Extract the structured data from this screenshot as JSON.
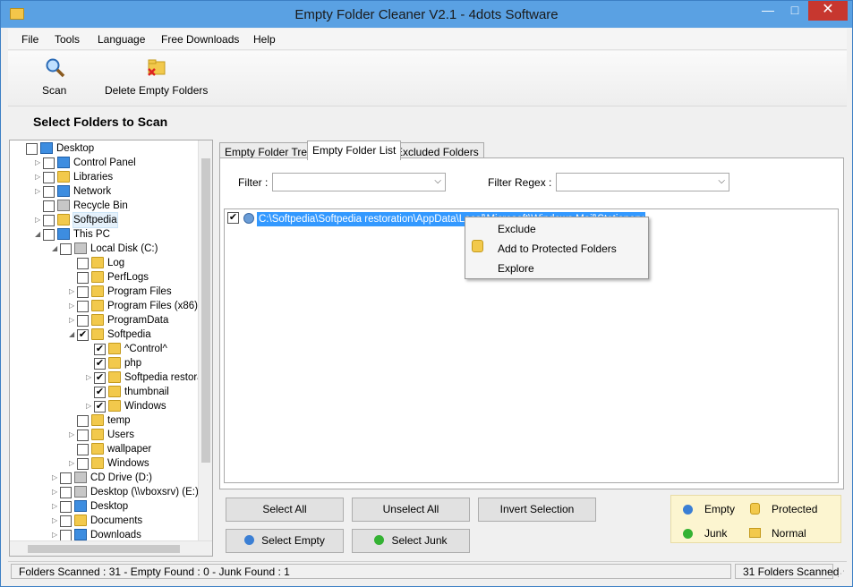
{
  "window": {
    "title": "Empty Folder Cleaner V2.1 - 4dots Software",
    "minimize_glyph": "—",
    "maximize_glyph": "□",
    "close_glyph": "✕"
  },
  "menu": [
    "File",
    "Tools",
    "Language",
    "Free Downloads",
    "Help"
  ],
  "toolbar": {
    "scan_label": "Scan",
    "delete_label": "Delete Empty Folders"
  },
  "section_title": "Select Folders to Scan",
  "tree": [
    {
      "label": "Desktop",
      "icon": "desktop-icon",
      "checked": false
    },
    {
      "label": "Control Panel",
      "icon": "control-panel-icon",
      "checked": false
    },
    {
      "label": "Libraries",
      "icon": "libraries-icon",
      "checked": false
    },
    {
      "label": "Network",
      "icon": "network-icon",
      "checked": false
    },
    {
      "label": "Recycle Bin",
      "icon": "recycle-bin-icon",
      "checked": false
    },
    {
      "label": "Softpedia",
      "icon": "user-icon",
      "checked": false
    },
    {
      "label": "This PC",
      "icon": "computer-icon",
      "checked": false
    },
    {
      "label": "Local Disk (C:)",
      "icon": "drive-icon",
      "checked": false
    },
    {
      "label": "Log",
      "icon": "folder-icon",
      "checked": false
    },
    {
      "label": "PerfLogs",
      "icon": "folder-icon",
      "checked": false
    },
    {
      "label": "Program Files",
      "icon": "folder-icon",
      "checked": false
    },
    {
      "label": "Program Files (x86)",
      "icon": "folder-icon",
      "checked": false
    },
    {
      "label": "ProgramData",
      "icon": "folder-icon",
      "checked": false
    },
    {
      "label": "Softpedia",
      "icon": "folder-icon",
      "checked": true
    },
    {
      "label": "^Control^",
      "icon": "folder-icon",
      "checked": true
    },
    {
      "label": "php",
      "icon": "folder-icon",
      "checked": true
    },
    {
      "label": "Softpedia restoration",
      "icon": "folder-icon",
      "checked": true
    },
    {
      "label": "thumbnail",
      "icon": "folder-icon",
      "checked": true
    },
    {
      "label": "Windows",
      "icon": "folder-icon",
      "checked": true
    },
    {
      "label": "temp",
      "icon": "folder-icon",
      "checked": false
    },
    {
      "label": "Users",
      "icon": "folder-icon",
      "checked": false
    },
    {
      "label": "wallpaper",
      "icon": "folder-icon",
      "checked": false
    },
    {
      "label": "Windows",
      "icon": "folder-icon",
      "checked": false
    },
    {
      "label": "CD Drive (D:)",
      "icon": "cd-drive-icon",
      "checked": false
    },
    {
      "label": "Desktop (\\\\vboxsrv) (E:)",
      "icon": "network-drive-icon",
      "checked": false
    },
    {
      "label": "Desktop",
      "icon": "desktop-folder-icon",
      "checked": false
    },
    {
      "label": "Documents",
      "icon": "documents-icon",
      "checked": false
    },
    {
      "label": "Downloads",
      "icon": "downloads-icon",
      "checked": false
    }
  ],
  "tabs": [
    "Empty Folder Tree",
    "Empty Folder List",
    "Excluded Folders"
  ],
  "active_tab": "Empty Folder List",
  "filter": {
    "label": "Filter :",
    "value": ""
  },
  "filter_regex": {
    "label": "Filter Regex :",
    "value": ""
  },
  "list_items": [
    {
      "path": "C:\\Softpedia\\Softpedia restoration\\AppData\\Local\\Microsoft\\Windows Mail\\Stationery",
      "checked": true,
      "status": "Empty"
    }
  ],
  "context_menu": [
    "Exclude",
    "Add to Protected Folders",
    "Explore"
  ],
  "buttons": {
    "select_all": "Select All",
    "unselect_all": "Unselect All",
    "invert": "Invert Selection",
    "select_empty": "Select Empty",
    "select_junk": "Select Junk"
  },
  "legend": {
    "empty": "Empty",
    "protected": "Protected",
    "junk": "Junk",
    "normal": "Normal"
  },
  "colors": {
    "empty": "#3b7fd4",
    "junk": "#34b233",
    "selection": "#3399ff",
    "titlebar": "#5aa1e3",
    "close": "#c7372f"
  },
  "status": {
    "left": "Folders Scanned : 31 - Empty Found : 0 - Junk Found : 1",
    "right": "31 Folders Scanned"
  },
  "checkmark": "✔"
}
